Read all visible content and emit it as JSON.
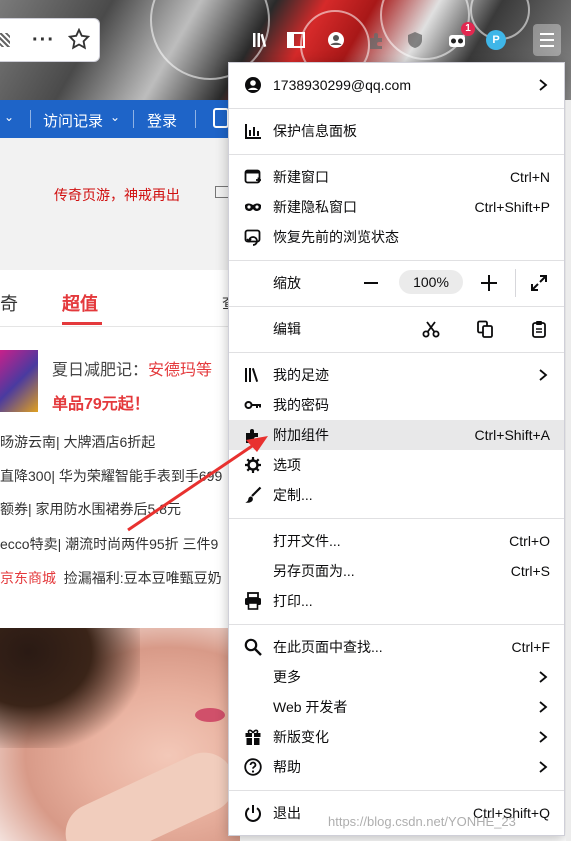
{
  "account": {
    "email": "1738930299@qq.com"
  },
  "menu": {
    "protections": "保护信息面板",
    "new_window": {
      "label": "新建窗口",
      "shortcut": "Ctrl+N"
    },
    "new_private": {
      "label": "新建隐私窗口",
      "shortcut": "Ctrl+Shift+P"
    },
    "restore_session": "恢复先前的浏览状态",
    "zoom": {
      "label": "缩放",
      "value": "100%"
    },
    "edit": {
      "label": "编辑"
    },
    "library": "我的足迹",
    "logins": "我的密码",
    "addons": {
      "label": "附加组件",
      "shortcut": "Ctrl+Shift+A"
    },
    "options": "选项",
    "customize": "定制...",
    "open_file": {
      "label": "打开文件...",
      "shortcut": "Ctrl+O"
    },
    "save_page": {
      "label": "另存页面为...",
      "shortcut": "Ctrl+S"
    },
    "print": "打印...",
    "find": {
      "label": "在此页面中查找...",
      "shortcut": "Ctrl+F"
    },
    "more": "更多",
    "web_developer": "Web 开发者",
    "whats_new": "新版变化",
    "help": "帮助",
    "quit": {
      "label": "退出",
      "shortcut": "Ctrl+Shift+Q"
    }
  },
  "toolbar": {
    "badge_count": "1",
    "profile_letter": "P"
  },
  "page": {
    "nav": {
      "item1": "访问记录",
      "item2": "登录"
    },
    "slogan": "传奇页游，神戒再出",
    "tabs": [
      "奇",
      "超值"
    ],
    "tab_more": "查",
    "promo": {
      "line1_prefix": "夏日减肥记：",
      "line1_highlight": "安德玛等",
      "line2": "单品79元起！"
    },
    "news": [
      "旸游云南| 大牌酒店6折起",
      "直降300| 华为荣耀智能手表到手699",
      "额券| 家用防水围裙券后5.8元",
      "ecco特卖| 潮流时尚两件95折 三件9",
      "京东商城  捡漏福利:豆本豆唯甄豆奶"
    ],
    "news5_store": "京东商城"
  },
  "watermark": "https://blog.csdn.net/YONHE_23",
  "colors": {
    "accent_red": "#e4393c",
    "nav_blue": "#1e64c8",
    "menu_hover": "#e8e8e9",
    "arrow": "#e8312f"
  }
}
